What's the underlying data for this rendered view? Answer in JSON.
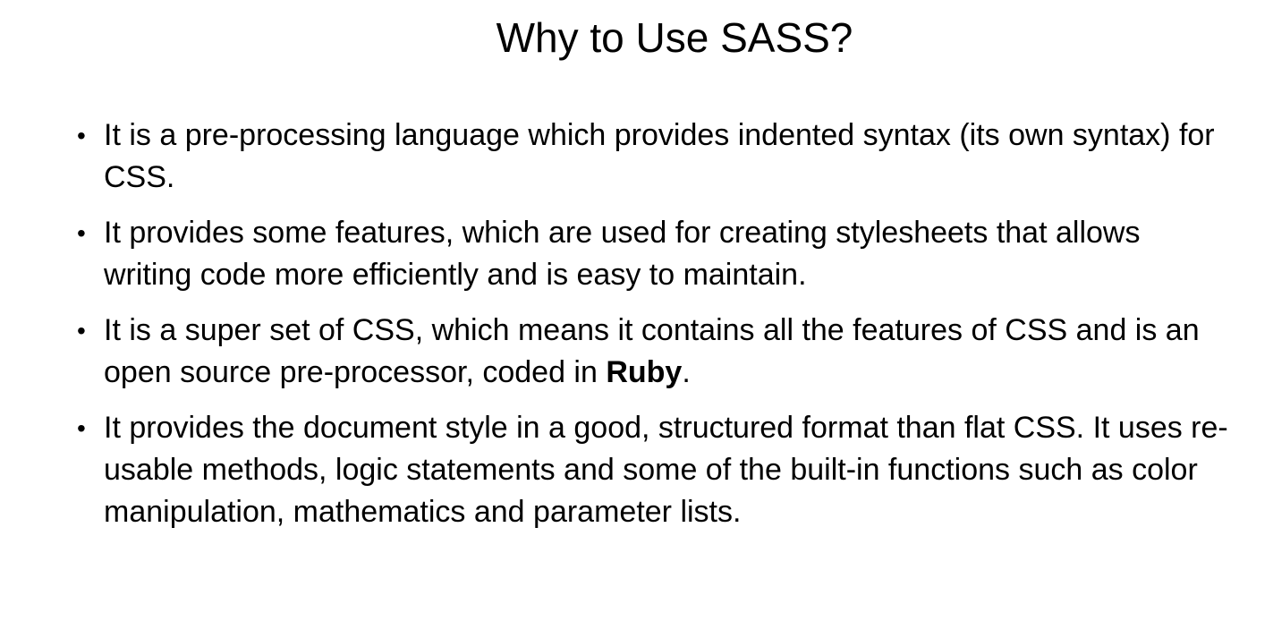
{
  "slide": {
    "title": "Why to Use SASS?",
    "bullets": [
      {
        "text": "It is a pre-processing language which provides indented syntax (its own syntax) for CSS."
      },
      {
        "text": "It provides some features, which are used for creating stylesheets that allows writing code more efficiently and is easy to maintain."
      },
      {
        "text_before": "It is a super set of CSS, which means it contains all the features of CSS and is an open source pre-processor, coded in ",
        "bold": "Ruby",
        "text_after": "."
      },
      {
        "text": "It provides the document style in a good, structured format than flat CSS. It uses re-usable methods, logic statements and some of the built-in functions such as color manipulation, mathematics and parameter lists."
      }
    ],
    "bullet_symbol": "•"
  }
}
